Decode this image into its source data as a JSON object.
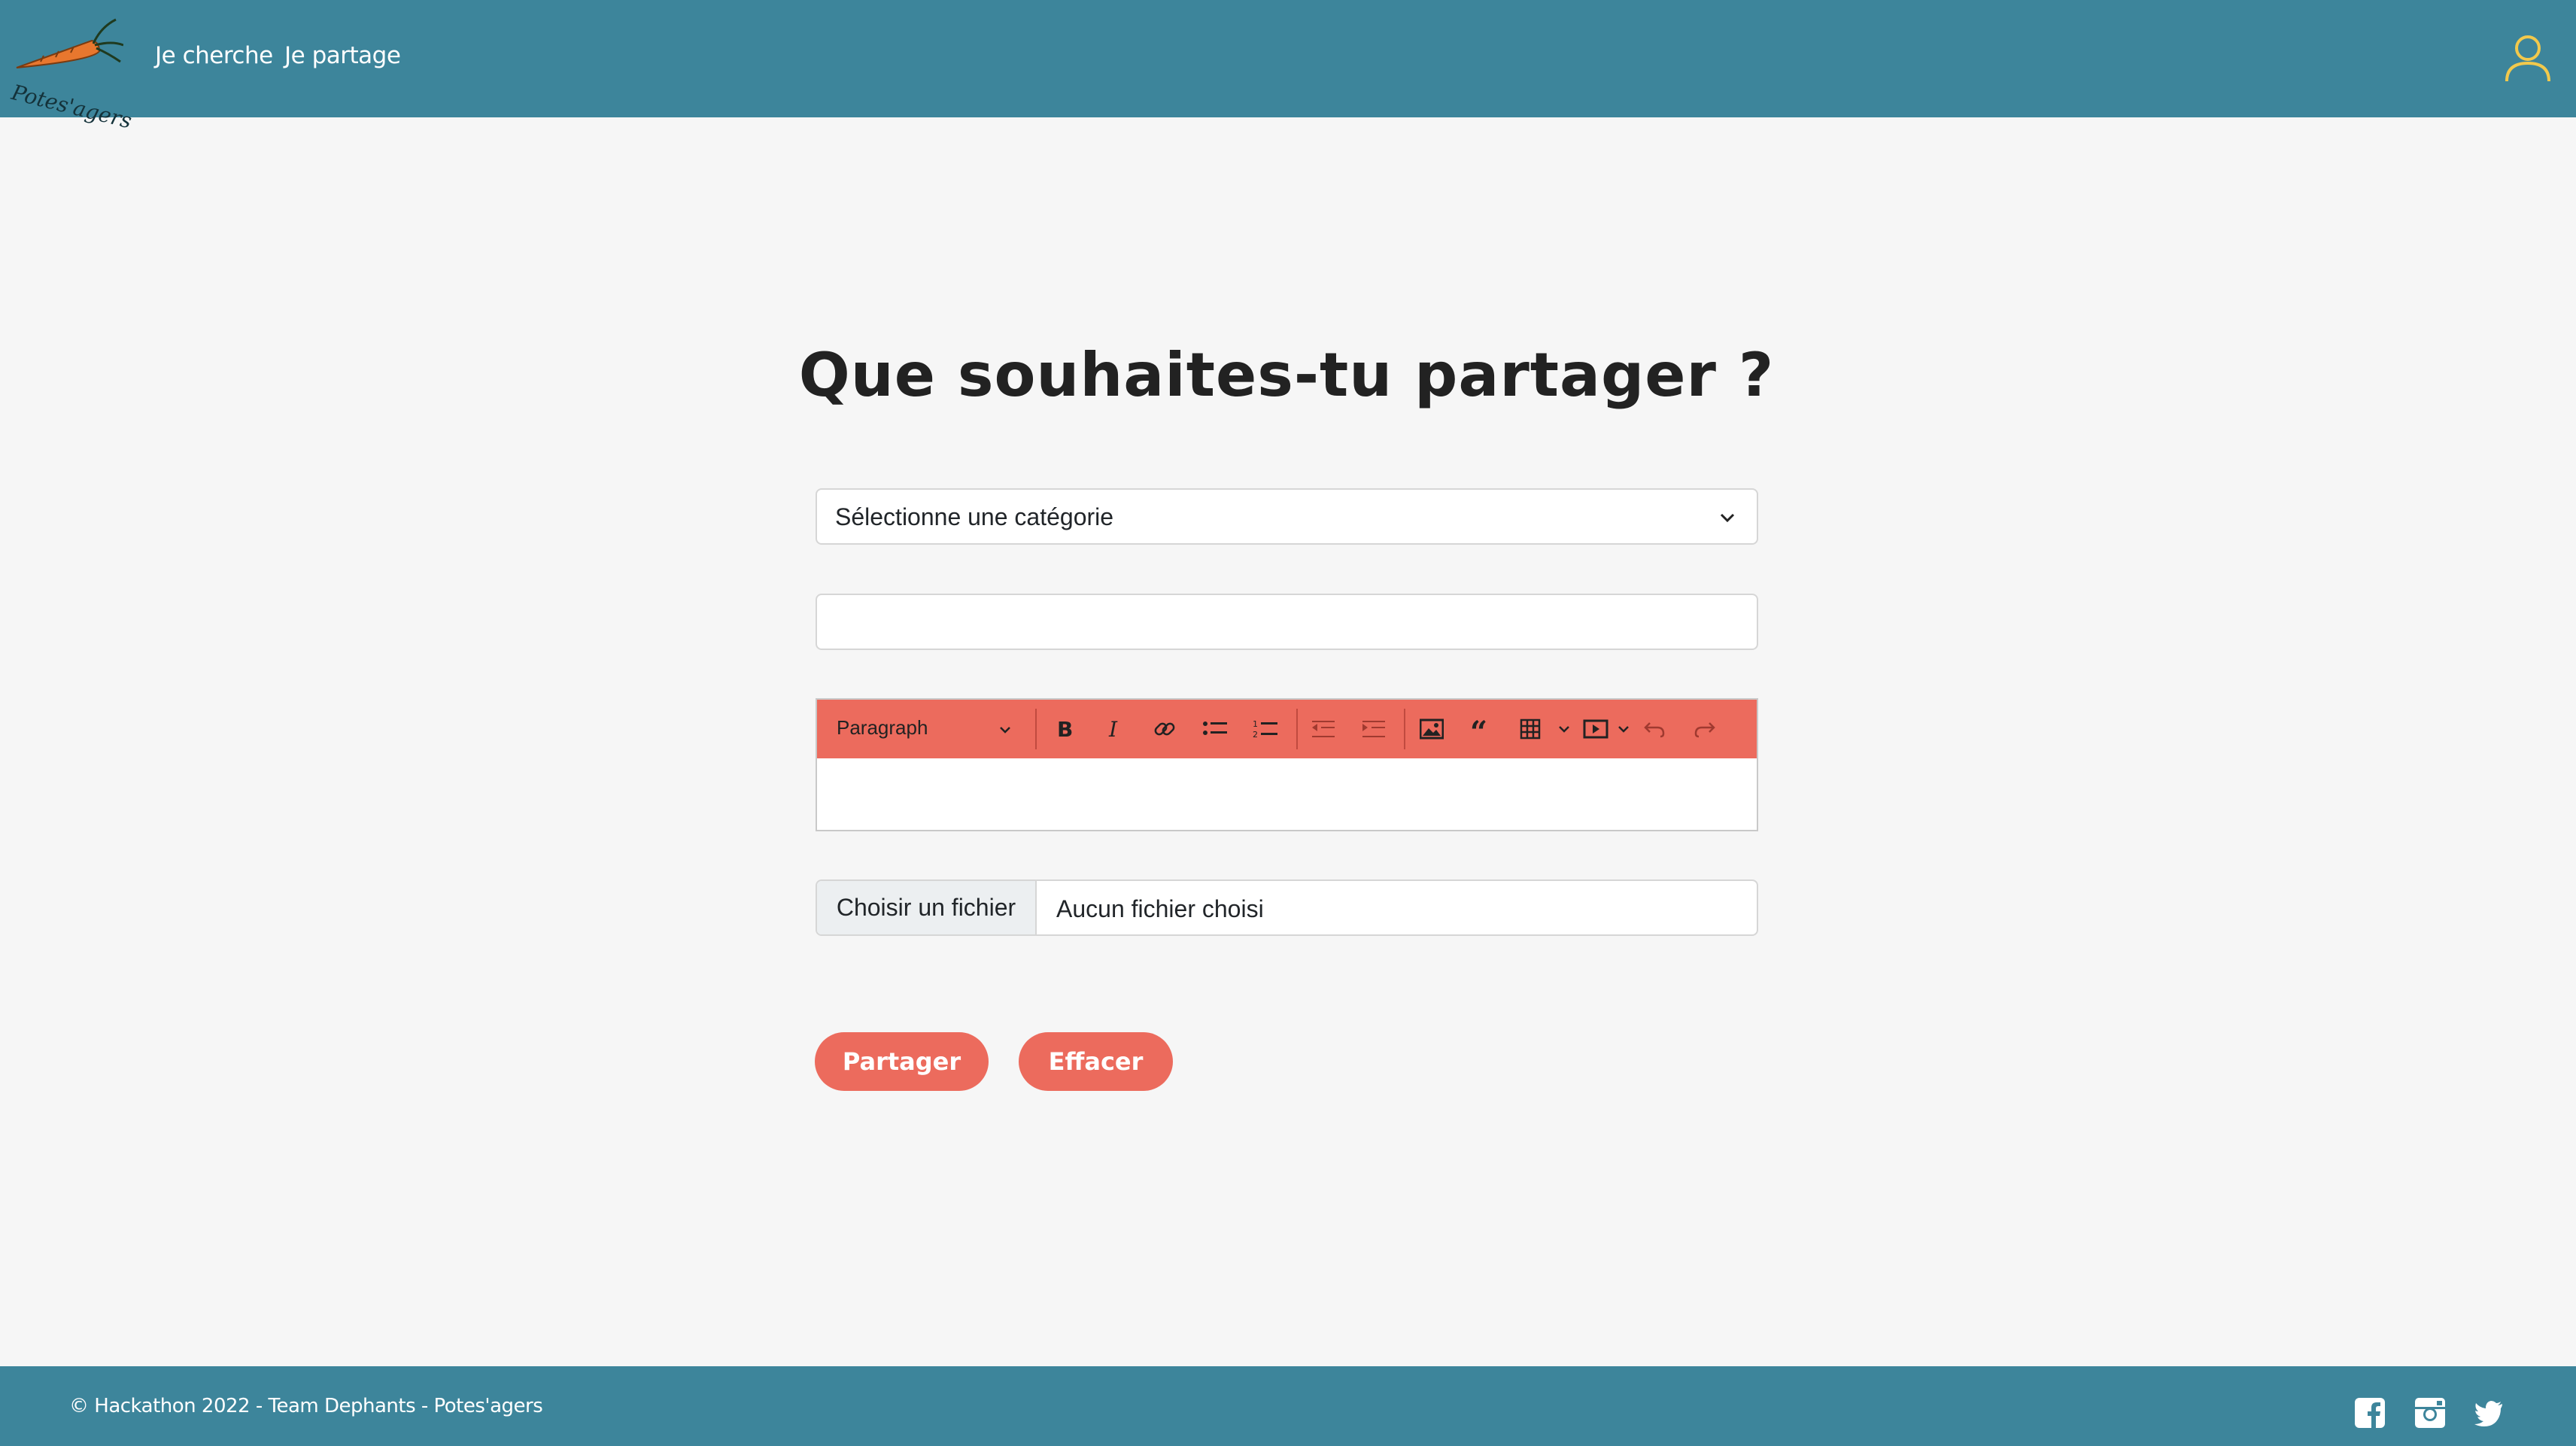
{
  "header": {
    "logo_text": "Potes'agers",
    "nav": [
      {
        "label": "Je cherche"
      },
      {
        "label": "Je partage"
      }
    ],
    "user_icon": "user-icon"
  },
  "main": {
    "title": "Que souhaites-tu partager ?",
    "category_select": {
      "selected": "Sélectionne une catégorie"
    },
    "title_input": {
      "value": ""
    },
    "editor": {
      "paragraph_label": "Paragraph",
      "tools": [
        "bold-icon",
        "italic-icon",
        "link-icon",
        "bulleted-list-icon",
        "numbered-list-icon",
        "outdent-icon",
        "indent-icon",
        "image-icon",
        "quote-icon",
        "table-icon",
        "media-icon",
        "undo-icon",
        "redo-icon"
      ],
      "content": ""
    },
    "file_input": {
      "button_label": "Choisir un fichier",
      "status": "Aucun fichier choisi"
    },
    "buttons": {
      "share_label": "Partager",
      "clear_label": "Effacer"
    }
  },
  "footer": {
    "copyright": "© Hackathon 2022 - Team Dephants - Potes'agers",
    "social": [
      "facebook-icon",
      "instagram-icon",
      "twitter-icon"
    ]
  },
  "colors": {
    "header_bg": "#3d859b",
    "accent": "#ec6b5d",
    "page_bg": "#f6f6f6",
    "user_icon": "#f2c94c"
  }
}
